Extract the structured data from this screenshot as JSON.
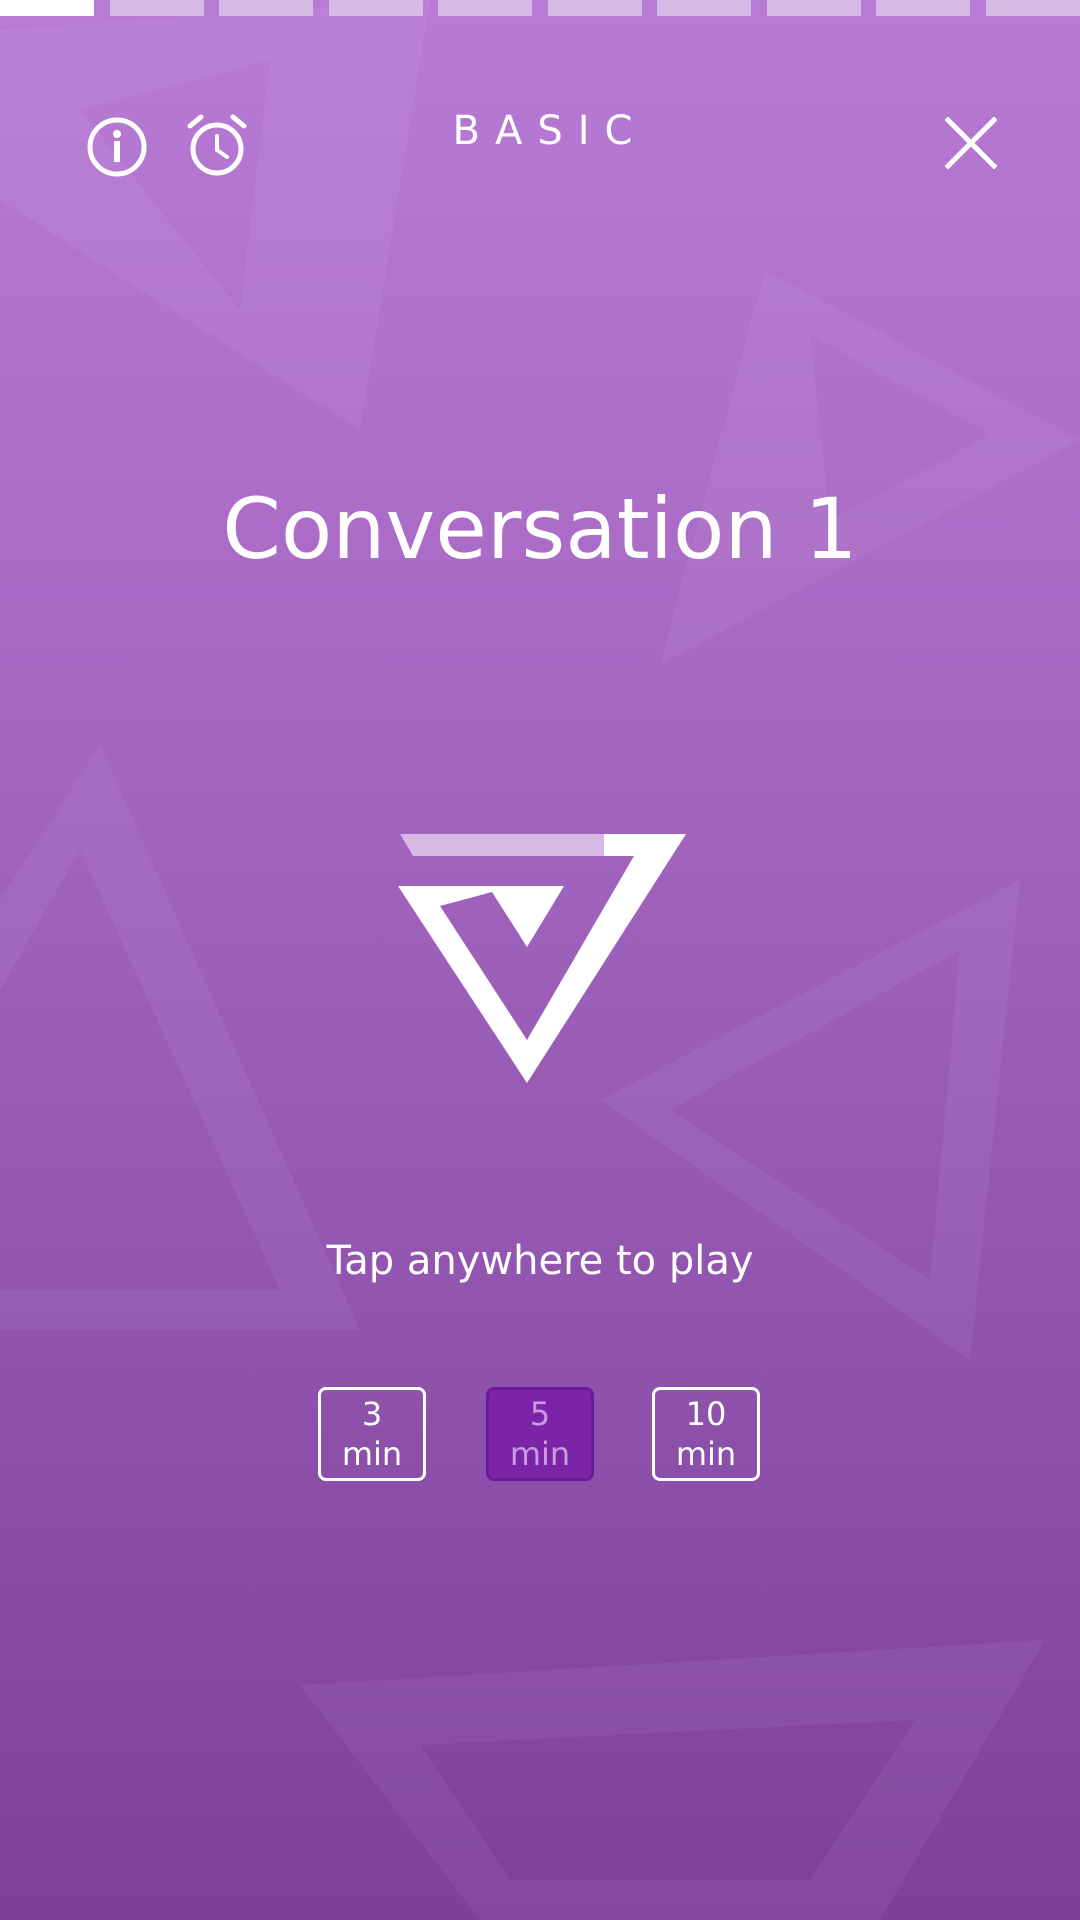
{
  "header": {
    "level": "BASIC",
    "icons": {
      "info": "info-icon",
      "timer": "alarm-clock-icon",
      "close": "close-icon"
    }
  },
  "progress": {
    "total_segments": 10,
    "active_segment": 1
  },
  "main": {
    "title": "Conversation 1",
    "hint": "Tap anywhere to play",
    "logo_icon": "triangle-logo-icon"
  },
  "durations": [
    {
      "value": "3",
      "unit": "min",
      "selected": false
    },
    {
      "value": "5",
      "unit": "min",
      "selected": true
    },
    {
      "value": "10",
      "unit": "min",
      "selected": false
    }
  ],
  "colors": {
    "background_top": "#b87bd5",
    "background_bottom": "#7e409a",
    "selected_button": "#7b24a8",
    "progress_inactive": "#d7b9e6",
    "foreground": "#ffffff"
  }
}
